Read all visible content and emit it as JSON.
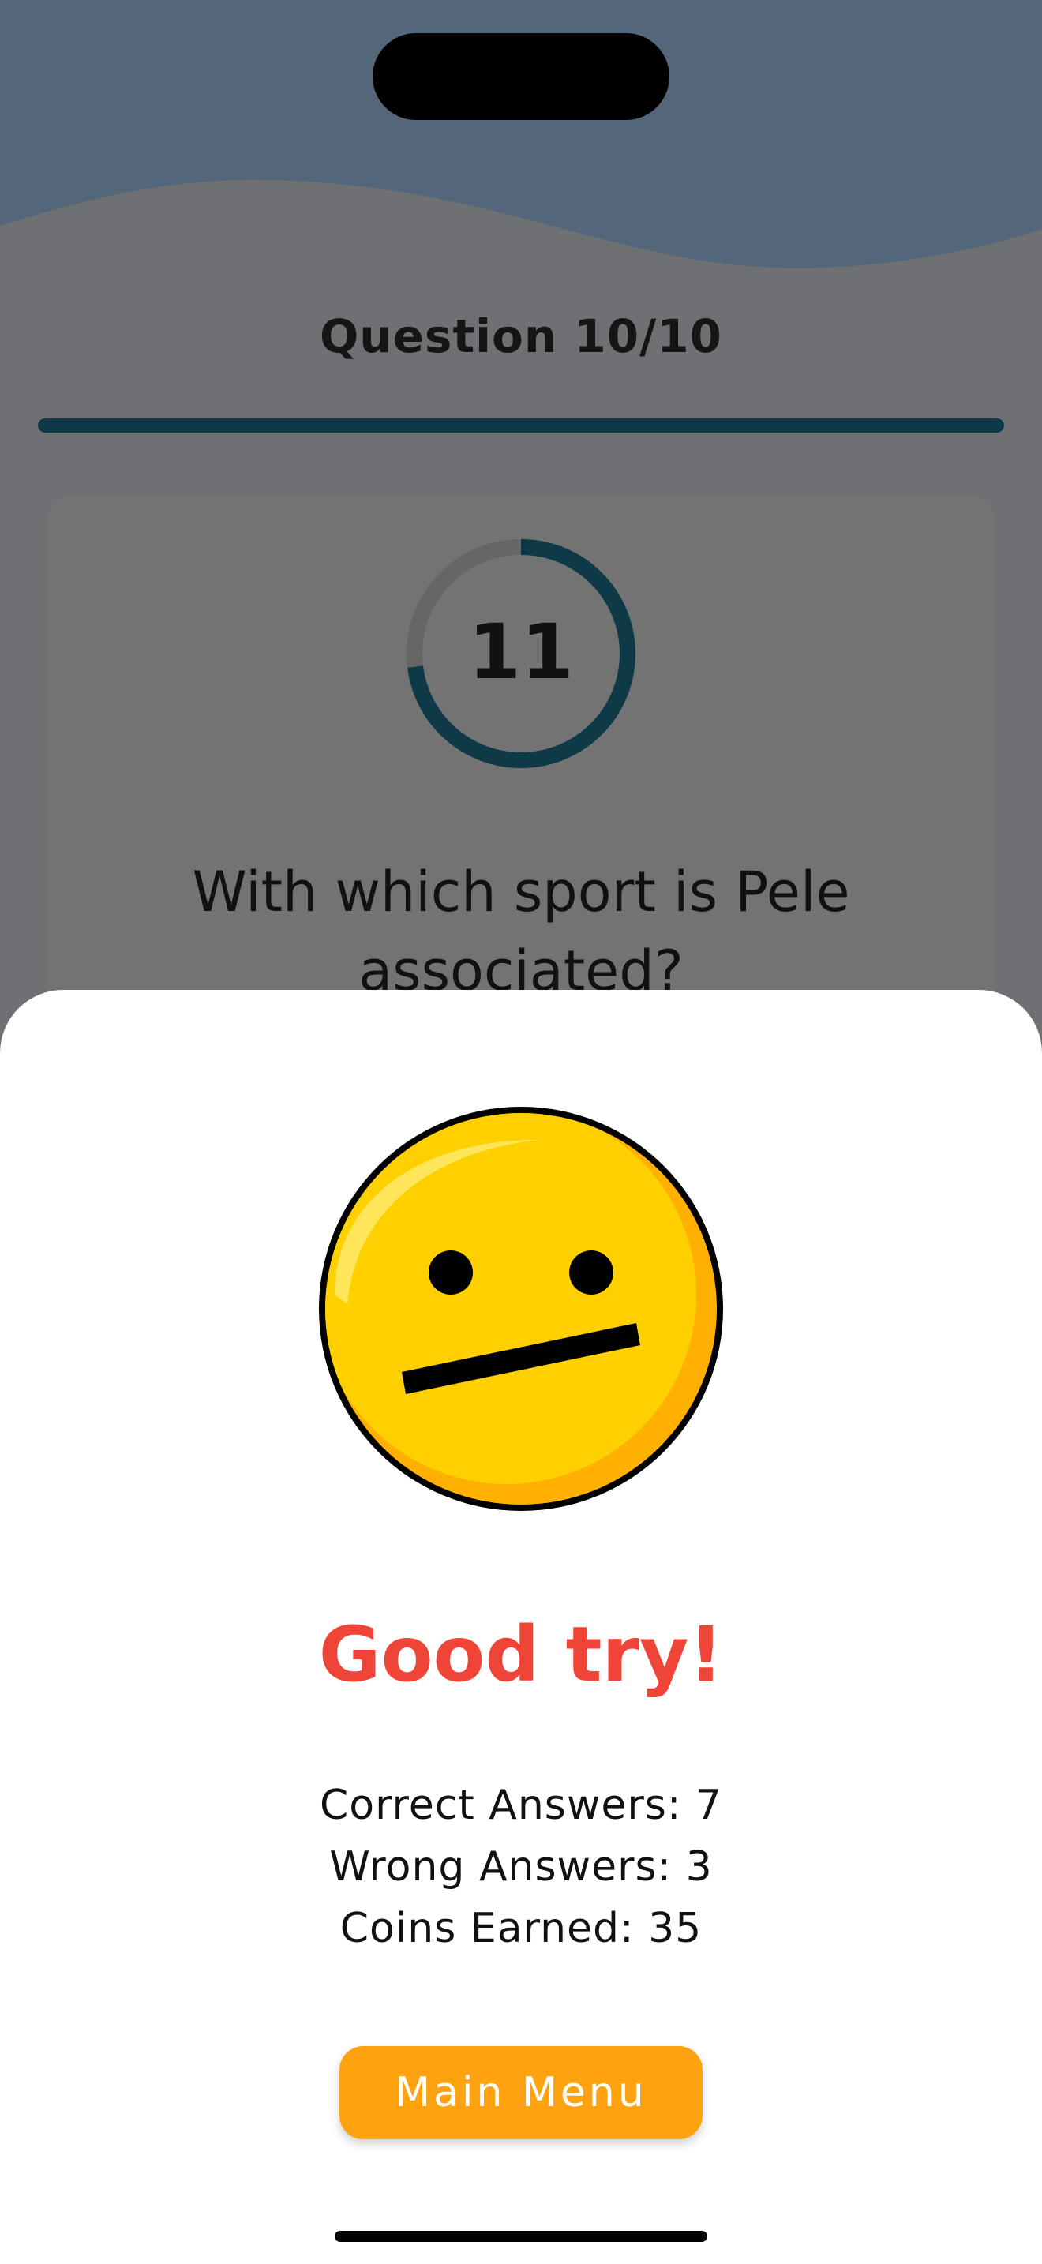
{
  "colors": {
    "wave_top": "#546679",
    "overlay_bg": "#6e7074",
    "accent_dark": "#0e3a48",
    "result_red": "#ef4438",
    "button_orange": "#ffa20f",
    "emoji_yellow": "#ffd000"
  },
  "quiz": {
    "question_counter": "Question 10/10",
    "progress_fraction": 1.0,
    "timer_value": "11",
    "timer_fraction": 0.73,
    "question_text": "With which sport is Pele associated?"
  },
  "result": {
    "emoji_icon": "neutral-face-icon",
    "title": "Good try!",
    "correct_label": "Correct Answers: 7",
    "wrong_label": "Wrong Answers: 3",
    "coins_label": "Coins Earned: 35",
    "main_menu_label": "Main Menu"
  }
}
